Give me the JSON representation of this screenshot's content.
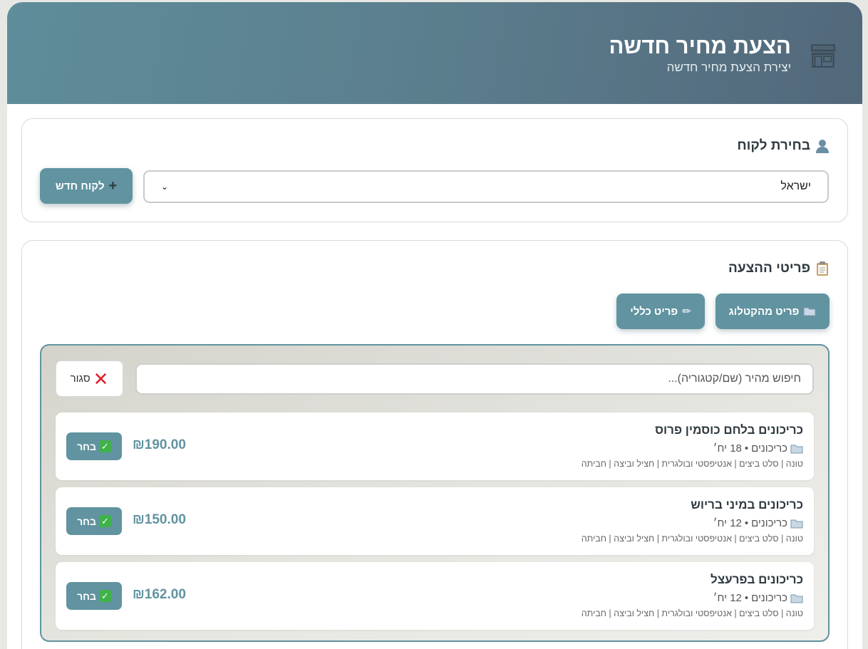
{
  "header": {
    "title": "הצעת מחיר חדשה",
    "subtitle": "יצירת הצעת מחיר חדשה",
    "icon": "store-icon"
  },
  "customer_section": {
    "title": "בחירת לקוח",
    "icon": "person-icon",
    "selected_customer": "ישראל",
    "new_customer_label": "לקוח חדש"
  },
  "items_section": {
    "title": "פריטי ההצעה",
    "icon": "clipboard-icon",
    "tab_catalog_label": "פריט מהקטלוג",
    "tab_general_label": "פריט כללי"
  },
  "catalog": {
    "search_placeholder": "חיפוש מהיר (שם/קטגוריה)...",
    "close_label": "סגור",
    "choose_label": "בחר",
    "products": [
      {
        "name": "כריכונים בלחם כוסמין פרוס",
        "category": "כריכונים",
        "quantity": "18 יח׳",
        "tags": "טונה | סלט ביצים | אנטיפסטי ובולגרית | חציל וביצה | חביתה",
        "price": "₪190.00"
      },
      {
        "name": "כריכונים במיני בריוש",
        "category": "כריכונים",
        "quantity": "12 יח׳",
        "tags": "טונה | סלט ביצים | אנטיפסטי ובולגרית | חציל וביצה | חביתה",
        "price": "₪150.00"
      },
      {
        "name": "כריכונים בפרעצל",
        "category": "כריכונים",
        "quantity": "12 יח׳",
        "tags": "טונה | סלט ביצים | אנטיפסטי ובולגרית | חציל וביצה | חביתה",
        "price": "₪162.00"
      }
    ]
  },
  "colors": {
    "accent": "#6193a0",
    "header_start": "#5f8d9a",
    "header_end": "#52687b"
  }
}
